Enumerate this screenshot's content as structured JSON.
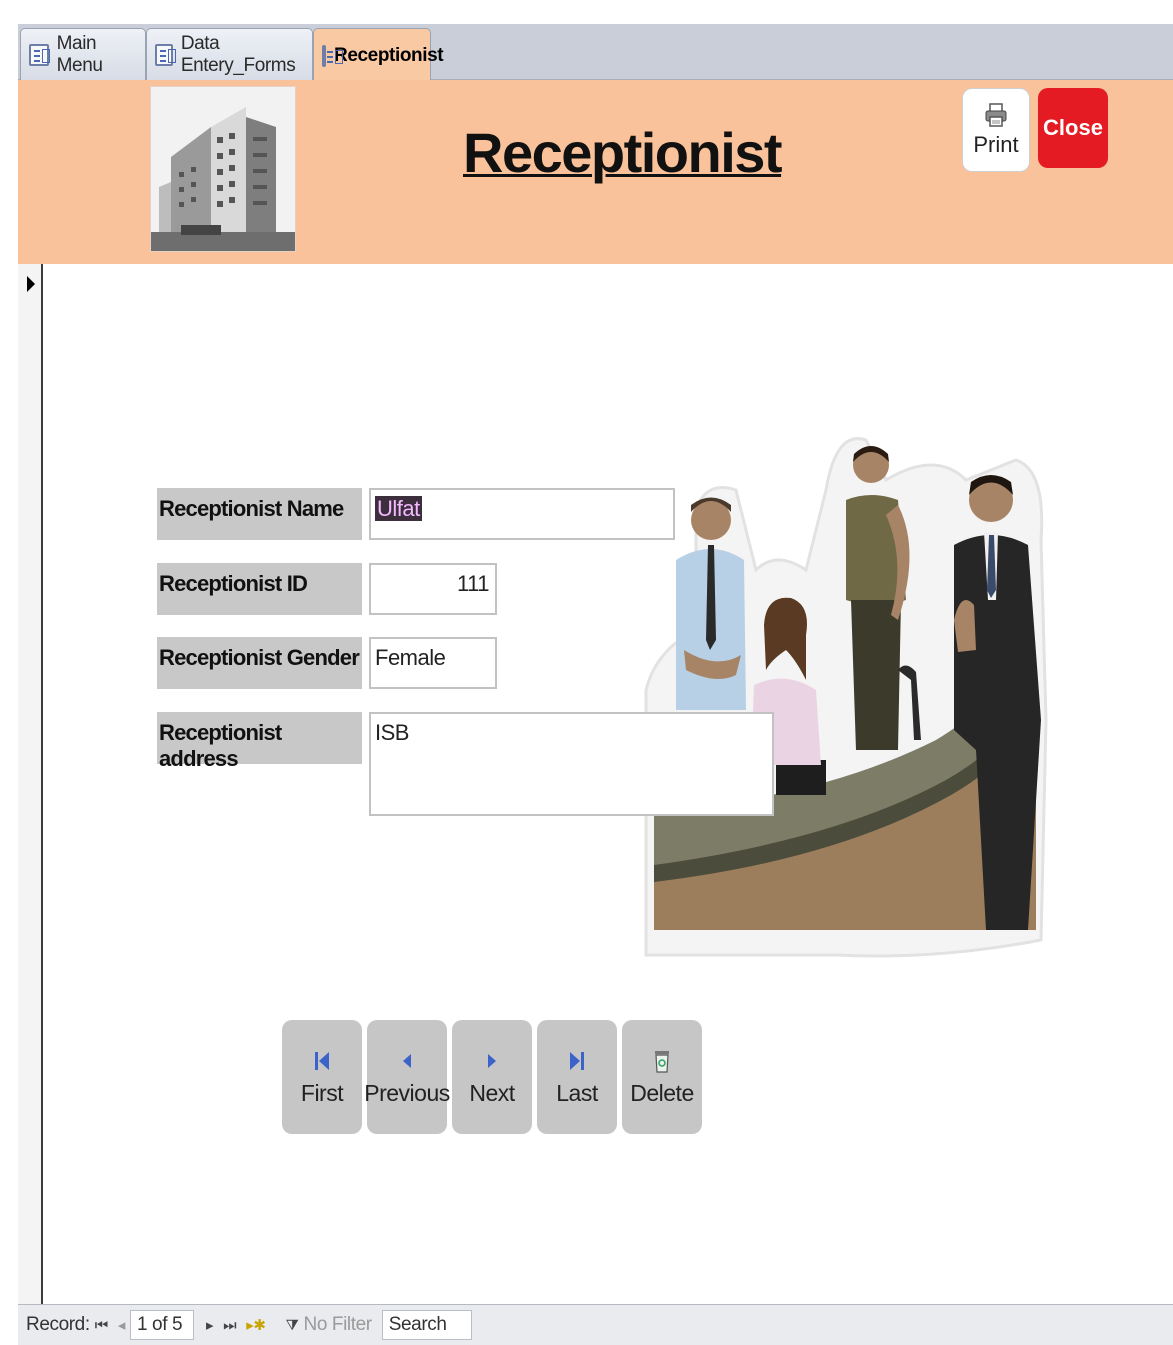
{
  "tabs": [
    {
      "label": "Main Menu",
      "icon": "form-icon",
      "active": false
    },
    {
      "label": "Data Entery_Forms",
      "icon": "form-icon",
      "active": false
    },
    {
      "label": "Receptionist",
      "icon": "form-icon",
      "active": true
    }
  ],
  "header": {
    "title": "Receptionist",
    "print_label": "Print",
    "close_label": "Close",
    "background_color": "#f9c29a",
    "close_color": "#e41b23"
  },
  "form": {
    "fields": [
      {
        "label": "Receptionist Name",
        "value": "Ulfat"
      },
      {
        "label": "Receptionist ID",
        "value": "111"
      },
      {
        "label": "Receptionist Gender",
        "value": "Female"
      },
      {
        "label": "Receptionist address",
        "value": "ISB"
      }
    ]
  },
  "nav_buttons": [
    {
      "label": "First",
      "icon": "first-record-icon"
    },
    {
      "label": "Previous",
      "icon": "previous-record-icon"
    },
    {
      "label": "Next",
      "icon": "next-record-icon"
    },
    {
      "label": "Last",
      "icon": "last-record-icon"
    },
    {
      "label": "Delete",
      "icon": "trash-icon"
    }
  ],
  "statusbar": {
    "record_label": "Record:",
    "position": "1 of 5",
    "filter_label": "No Filter",
    "search_label": "Search"
  }
}
